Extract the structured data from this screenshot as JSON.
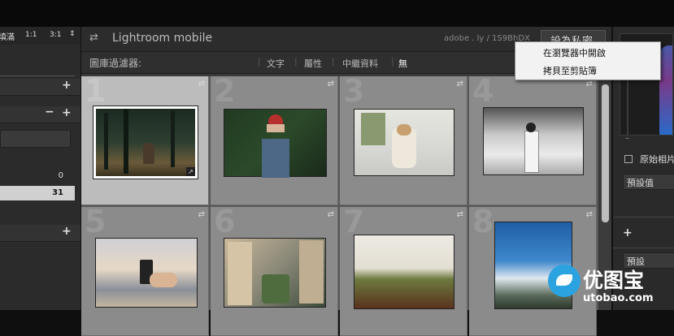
{
  "top": {
    "zoom_fill": "填滿",
    "zoom_1_1": "1:1",
    "zoom_3_1": "3:1"
  },
  "left_panel": {
    "count_a": "0",
    "count_b": "31"
  },
  "lightroom_bar": {
    "title": "Lightroom mobile",
    "url": "adobe . ly / 1S9BhDX",
    "set_private_button": "設為私密"
  },
  "filter_bar": {
    "label": "圖庫過濾器:",
    "options": [
      "文字",
      "屬性",
      "中繼資料",
      "無"
    ]
  },
  "context_menu": {
    "items": [
      "在瀏覽器中開啟",
      "拷貝至剪貼簿"
    ]
  },
  "grid": {
    "numbers": [
      "1",
      "2",
      "3",
      "4",
      "5",
      "6",
      "7",
      "8"
    ]
  },
  "right_panel": {
    "original_photo": "原始相片",
    "preset_value": "預設值",
    "preset": "預設"
  },
  "watermark": {
    "brand": "优图宝",
    "url": "utobao.com"
  },
  "colors": {
    "accent_blue": "#2aa3e0",
    "selected_cell": "#bcbcbc"
  }
}
